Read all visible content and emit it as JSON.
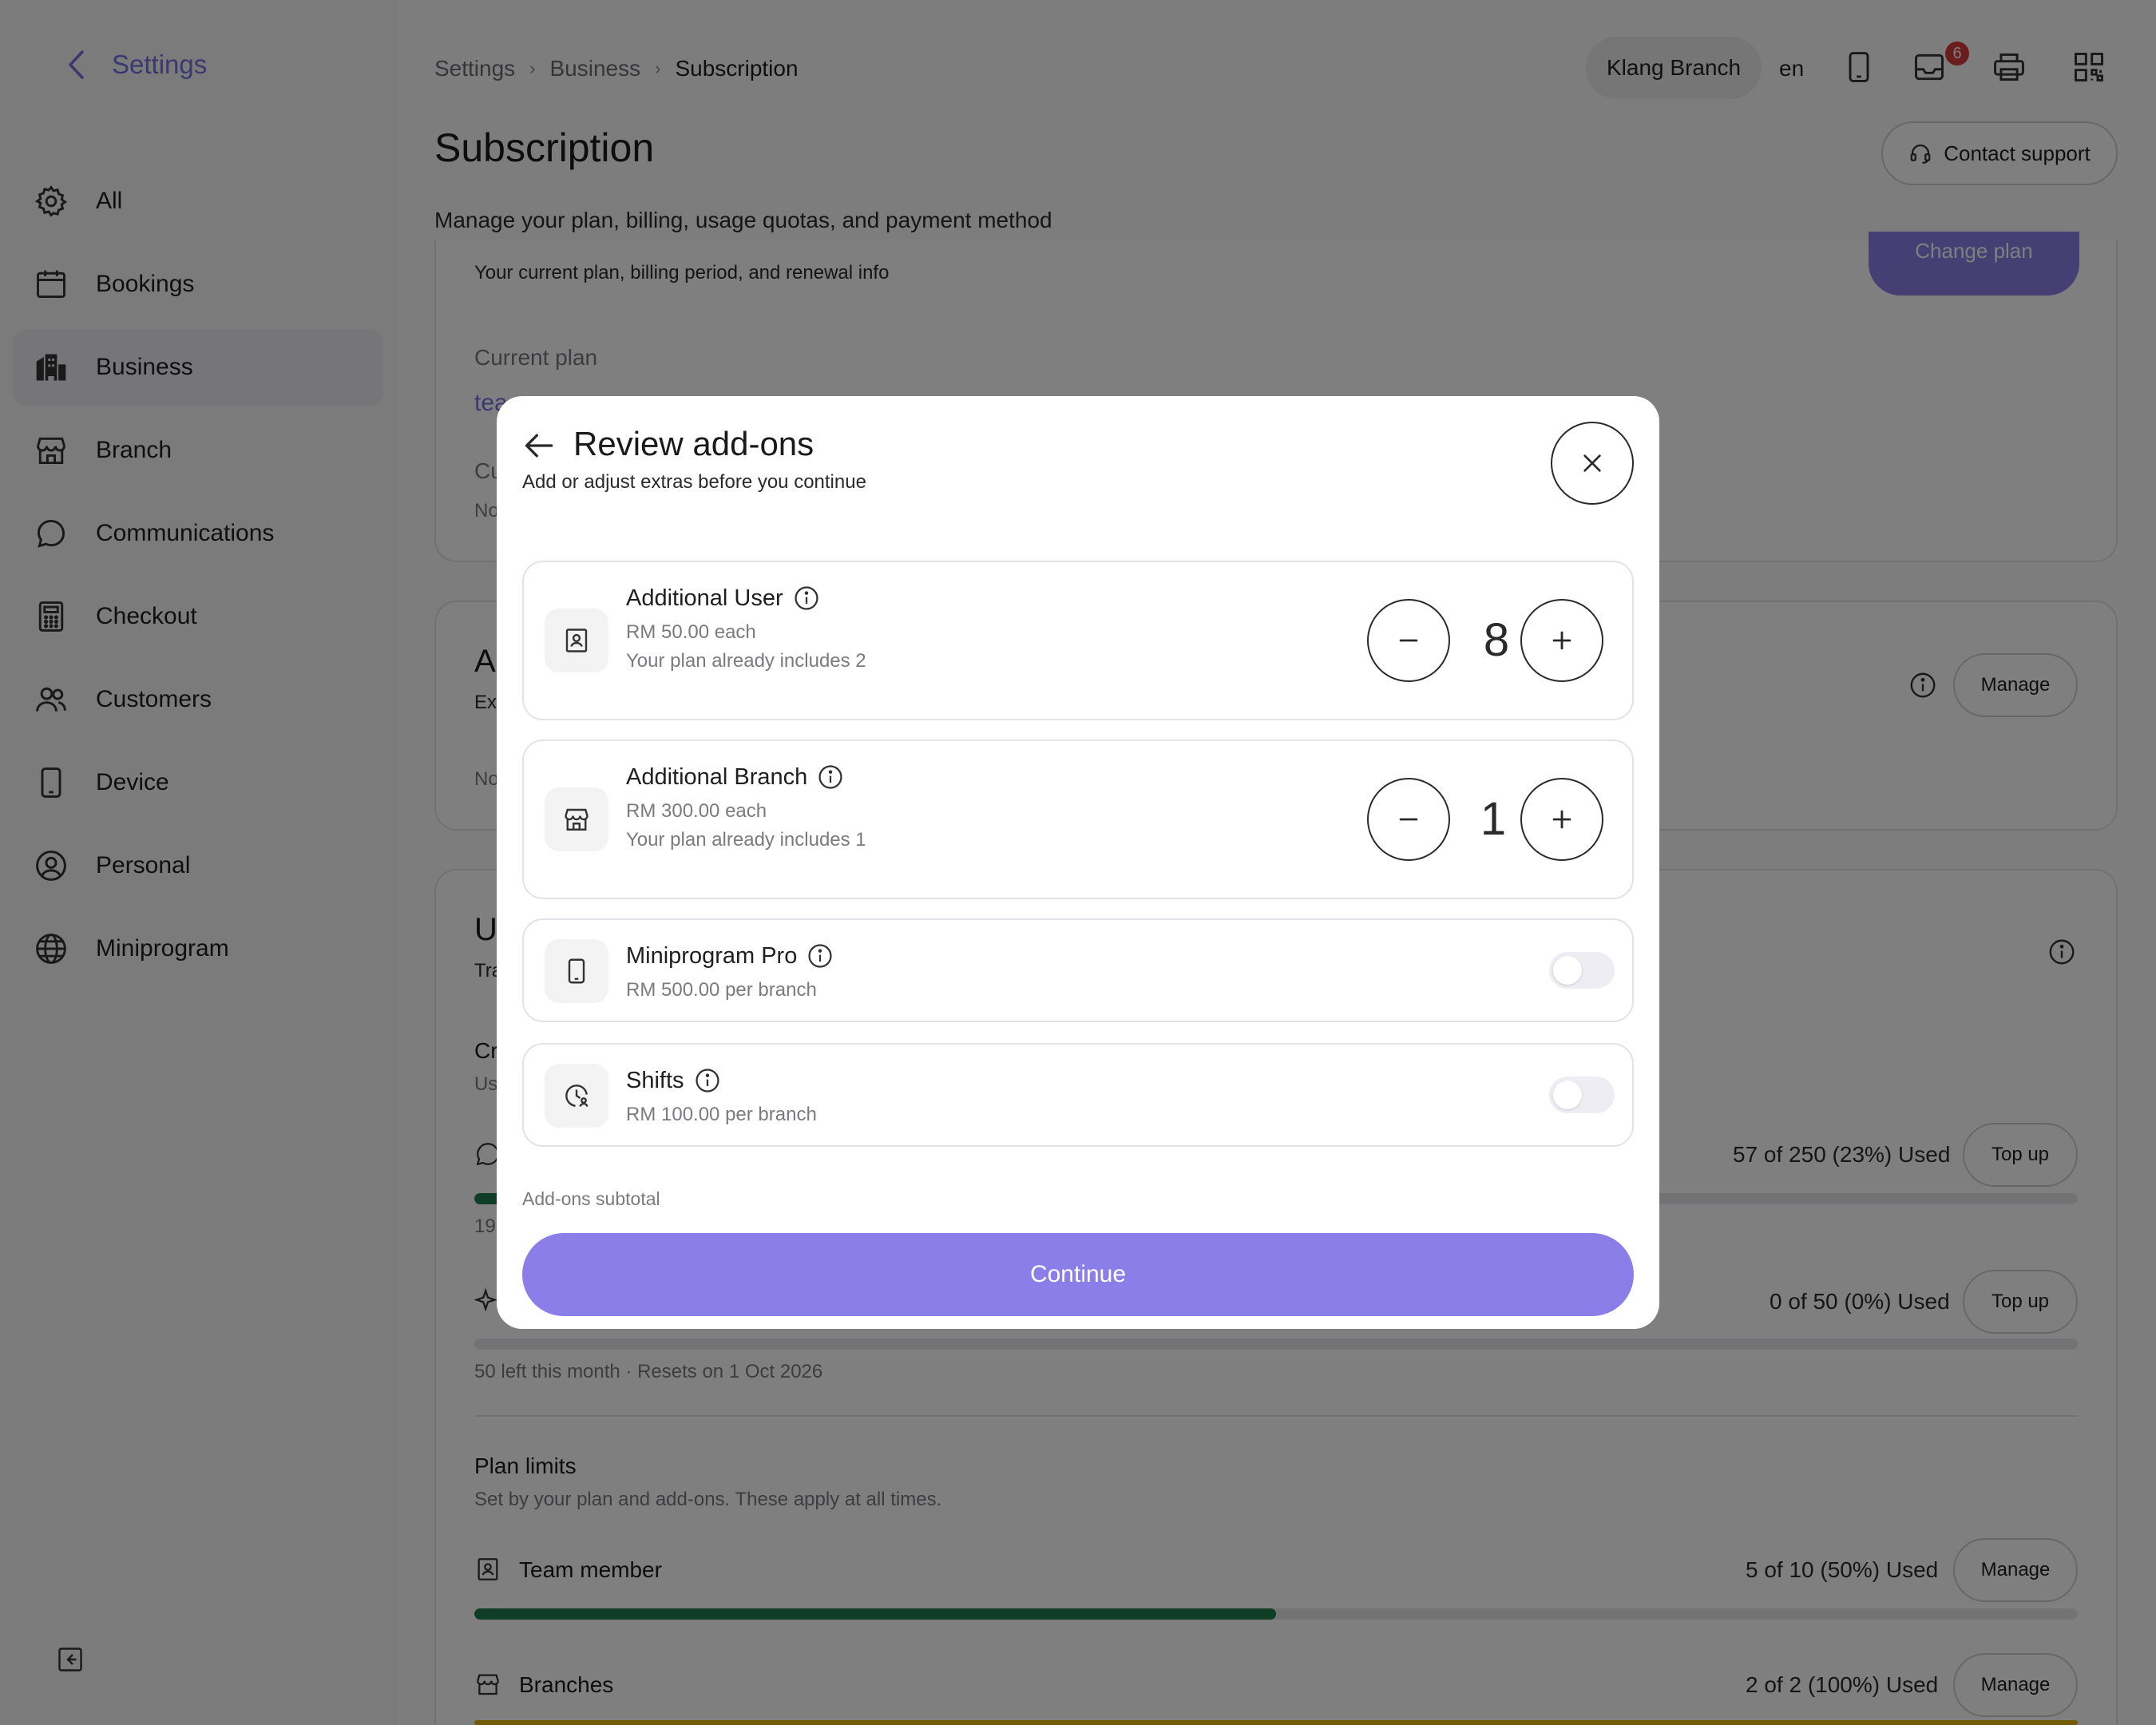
{
  "sidebar": {
    "title": "Settings",
    "items": [
      {
        "label": "All",
        "icon": "gear-icon"
      },
      {
        "label": "Bookings",
        "icon": "calendar-icon"
      },
      {
        "label": "Business",
        "icon": "building-icon",
        "active": true
      },
      {
        "label": "Branch",
        "icon": "store-icon"
      },
      {
        "label": "Communications",
        "icon": "chat-icon"
      },
      {
        "label": "Checkout",
        "icon": "calculator-icon"
      },
      {
        "label": "Customers",
        "icon": "users-icon"
      },
      {
        "label": "Device",
        "icon": "phone-icon"
      },
      {
        "label": "Personal",
        "icon": "user-circle-icon"
      },
      {
        "label": "Miniprogram",
        "icon": "globe-icon"
      }
    ]
  },
  "header": {
    "breadcrumb": [
      "Settings",
      "Business",
      "Subscription"
    ],
    "branch": "Klang Branch",
    "lang": "en",
    "notification_count": "6",
    "contact_support": "Contact support"
  },
  "page": {
    "title": "Subscription",
    "subtitle": "Manage your plan, billing, usage quotas, and payment method"
  },
  "plan_card": {
    "change_plan": "Change plan",
    "description": "Your current plan, billing period, and renewal info",
    "current_plan_label": "Current plan",
    "plan_name_partial": "tea",
    "line2_partial": "Cu",
    "line3_partial": "No"
  },
  "addons_card": {
    "title_partial": "A",
    "desc_partial": "Ex",
    "line_partial": "No",
    "manage": "Manage"
  },
  "usage_card": {
    "title_partial": "U",
    "desc_partial": "Tra",
    "credits_title_partial": "Cr",
    "credits_desc_partial": "Us",
    "whatsapp_used": "57 of 250 (23%) Used",
    "whatsapp_fraction": 0.23,
    "whatsapp_note_partial": "19",
    "ai_used": "0 of 50 (0%) Used",
    "ai_fraction": 0.0,
    "ai_note": "50 left this month · Resets on 1 Oct 2026",
    "top_up": "Top up",
    "plan_limits_title": "Plan limits",
    "plan_limits_desc": "Set by your plan and add-ons. These apply at all times.",
    "team_member_label": "Team member",
    "team_member_used": "5 of 10 (50%) Used",
    "team_member_fraction": 0.5,
    "branches_label": "Branches",
    "branches_used": "2 of 2 (100%) Used",
    "branches_fraction": 1.0,
    "manage": "Manage"
  },
  "modal": {
    "title": "Review add-ons",
    "subtitle": "Add or adjust extras before you continue",
    "addons": [
      {
        "name": "Additional User",
        "price": "RM 50.00 each",
        "note": "Your plan already includes 2",
        "qty": "8",
        "icon": "user-badge-icon"
      },
      {
        "name": "Additional Branch",
        "price": "RM 300.00 each",
        "note": "Your plan already includes 1",
        "qty": "1",
        "icon": "store-icon"
      },
      {
        "name": "Miniprogram Pro",
        "price": "RM 500.00 per branch",
        "enabled": false,
        "icon": "phone-icon"
      },
      {
        "name": "Shifts",
        "price": "RM 100.00 per branch",
        "enabled": false,
        "icon": "clock-user-icon"
      }
    ],
    "subtotal_label": "Add-ons subtotal",
    "continue": "Continue"
  },
  "colors": {
    "accent": "#8b7ee8",
    "sidebar_title": "#7b6fe0",
    "progress_green": "#1f7a4a",
    "progress_yellow": "#e6b800",
    "badge_red": "#d63a3a"
  }
}
